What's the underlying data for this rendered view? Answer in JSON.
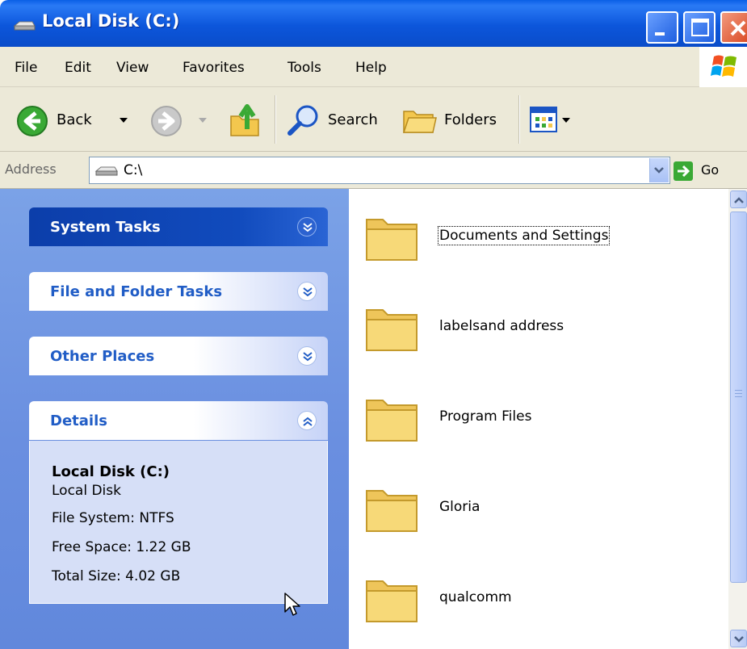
{
  "window": {
    "title": "Local Disk (C:)",
    "title_icon": "drive-icon",
    "controls": [
      "minimize",
      "maximize",
      "close"
    ]
  },
  "menu": {
    "items": [
      "File",
      "Edit",
      "View",
      "Favorites",
      "Tools",
      "Help"
    ]
  },
  "toolbar": {
    "back_label": "Back",
    "search_label": "Search",
    "folders_label": "Folders"
  },
  "address": {
    "label": "Address",
    "value": "C:\\",
    "go_label": "Go"
  },
  "task_pane": {
    "panels": [
      {
        "title": "System Tasks",
        "state": "collapsed"
      },
      {
        "title": "File and Folder Tasks",
        "state": "collapsed"
      },
      {
        "title": "Other Places",
        "state": "collapsed"
      },
      {
        "title": "Details",
        "state": "expanded"
      }
    ],
    "details": {
      "name": "Local Disk (C:)",
      "type": "Local Disk",
      "file_system": "File System: NTFS",
      "free_space": "Free Space: 1.22 GB",
      "total_size": "Total Size: 4.02 GB"
    }
  },
  "folders": [
    {
      "name": "Documents and Settings",
      "focused": true
    },
    {
      "name": "labelsand address",
      "focused": false
    },
    {
      "name": "Program Files",
      "focused": false
    },
    {
      "name": "Gloria",
      "focused": false
    },
    {
      "name": "qualcomm",
      "focused": false
    }
  ],
  "colors": {
    "titlebar": "#0a5fe6",
    "task_pane": "#6a8fe0",
    "panel_title": "#215dc6",
    "close_button": "#d8431c",
    "folder": "#f7d978"
  }
}
